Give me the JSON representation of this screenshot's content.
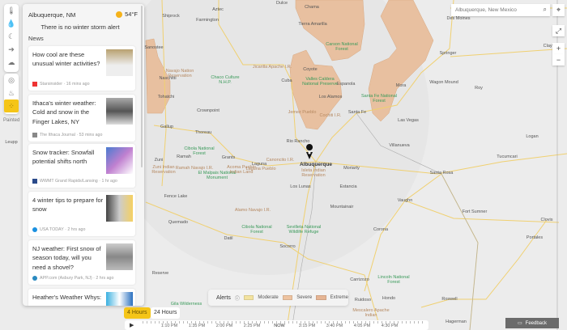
{
  "location": {
    "name": "Albuquerque, NM",
    "temperature": "54°F",
    "weather_icon": "sunny-icon",
    "alert_message": "There is no winter storm alert"
  },
  "news": {
    "heading": "News",
    "items": [
      {
        "title": "How cool are these unusual winter activities?",
        "source": "Starsinsider · 16 mins ago"
      },
      {
        "title": "Ithaca's winter weather: Cold and snow in the Finger Lakes, NY",
        "source": "The Ithaca Journal · 53 mins ago"
      },
      {
        "title": "Snow tracker: Snowfall potential shifts north",
        "source": "WWMT Grand Rapids/Lansing · 1 hr ago"
      },
      {
        "title": "4 winter tips to prepare for snow",
        "source": "USA TODAY · 2 hrs ago"
      },
      {
        "title": "NJ weather: First snow of season today, will you need a shovel?",
        "source": "APP.com (Asbury Park, NJ) · 2 hrs ago"
      },
      {
        "title": "Heather's Weather Whys:",
        "source": ""
      }
    ]
  },
  "toolbar": {
    "items": [
      "thermometer-icon",
      "precipitation-icon",
      "wind-icon",
      "arrow-icon",
      "cloud-icon",
      "radar-icon",
      "drop-icon",
      "painted-icon"
    ],
    "active_label": "Painted"
  },
  "search": {
    "value": "Albuquerque, New Mexico"
  },
  "legend": {
    "title": "Alerts",
    "items": [
      {
        "label": "Moderate",
        "color": "#f3e3a0"
      },
      {
        "label": "Severe",
        "color": "#eec3a0"
      },
      {
        "label": "Extreme",
        "color": "#e6b594"
      }
    ]
  },
  "timeline": {
    "ranges": [
      "4 Hours",
      "24 Hours"
    ],
    "active_range": "4 Hours",
    "ticks": [
      "1:10 PM",
      "1:35 PM",
      "2:00 PM",
      "2:25 PM",
      "NOW",
      "3:15 PM",
      "3:40 PM",
      "4:05 PM",
      "4:30 PM"
    ]
  },
  "feedback": "Feedback",
  "map_labels": [
    "Farmington",
    "Aztec",
    "Shiprock",
    "Dulce",
    "Chama",
    "Tierra Amarilla",
    "Sanostee",
    "Naschitti",
    "Tohatchi",
    "Crownpoint",
    "Gallup",
    "Thoreau",
    "Cuba",
    "Coyote",
    "Espanola",
    "Los Alamos",
    "Santa Fe",
    "Rio Rancho",
    "Albuquerque",
    "Grants",
    "Ramah",
    "Zuni",
    "Laguna",
    "Moriarty",
    "Los Lunas",
    "Estancia",
    "Mountainair",
    "Fence Lake",
    "Quemado",
    "Datil",
    "Socorro",
    "Reserve",
    "Carrizozo",
    "Corona",
    "Vaughn",
    "Santa Rosa",
    "Villanueva",
    "Las Vegas",
    "Mora",
    "Wagon Mound",
    "Springer",
    "Roy",
    "Des Moines",
    "Clayton",
    "Logan",
    "Tucumcari",
    "Fort Sumner",
    "Clovis",
    "Portales",
    "Hondo",
    "Ruidoso",
    "Roswell",
    "Hagerman",
    "Leupp",
    "Gila Wilderness",
    "Carson National Forest",
    "Chaco Culture N.H.P.",
    "Valles Caldera National Preserve",
    "Santa Fe National Forest",
    "Cibola National Forest",
    "El Malpais National Monument",
    "Cibola National Forest",
    "Sevilleta National Wildlife Refuge",
    "Lincoln National Forest",
    "Jicarilla Apache I.R.",
    "Navajo Nation Reservation",
    "Jemez Pueblo",
    "Cochiti I.R.",
    "Canoncito I.R.",
    "Acoma Pueblo Indian Land",
    "Laguna Pueblo",
    "Isleta Indian Reservation",
    "Zuni Indian Reservation",
    "Ramah Navajo I.R.",
    "Alamo Navajo I.R.",
    "Mescalero Apache Indian"
  ],
  "alert_color": "#e8c0a0"
}
